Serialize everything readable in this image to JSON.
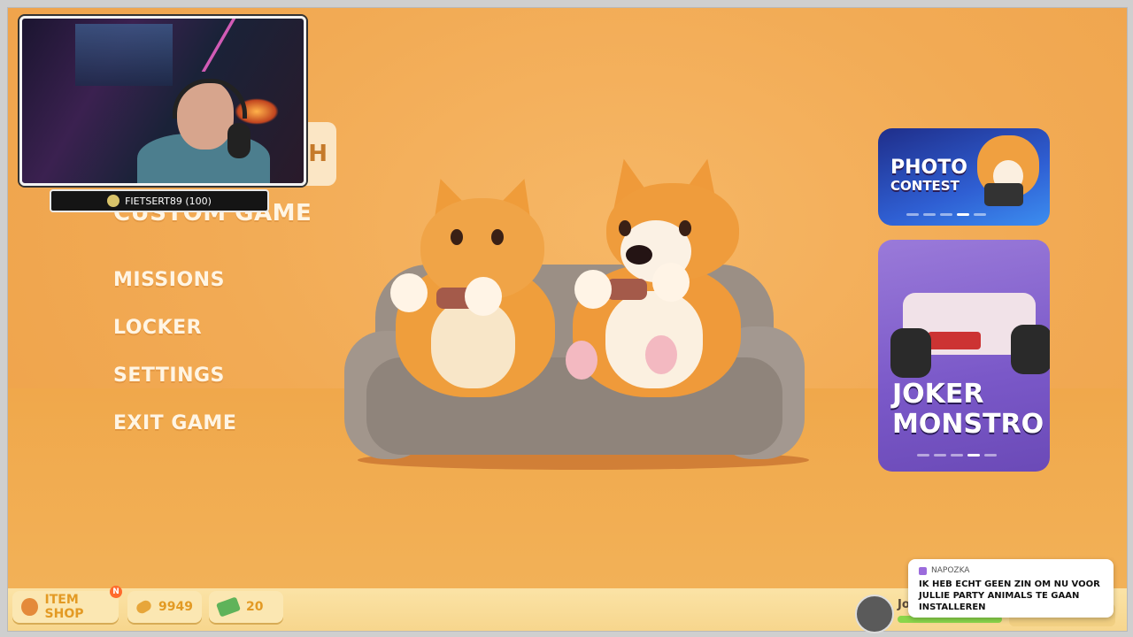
{
  "stream_overlay": {
    "webcam_label": "streamer-webcam",
    "subscriber": "FIETSERT89 (100)"
  },
  "main_menu": {
    "custom_game": "CUSTOM GAME",
    "items": [
      {
        "label": "MISSIONS"
      },
      {
        "label": "LOCKER"
      },
      {
        "label": "SETTINGS"
      },
      {
        "label": "EXIT GAME"
      }
    ],
    "top_button_glyph": "H"
  },
  "promos": {
    "photo_contest": {
      "line1": "PHOTO",
      "line2": "CONTEST"
    },
    "joker": {
      "line1": "JOKER",
      "line2": "MONSTRO"
    }
  },
  "bottom_bar": {
    "item_shop": "ITEM SHOP",
    "shop_badge": "N",
    "bones": "9949",
    "cash": "20",
    "player_name": "Jo"
  },
  "chat": {
    "user": "NAPOZKA",
    "message": "IK HEB ECHT GEEN ZIN OM NU VOOR JULLIE PARTY ANIMALS TE GAAN INSTALLEREN"
  },
  "colors": {
    "background": "#f2ab55",
    "menu_text": "#fff5e4",
    "accent_orange": "#e39a24",
    "card_photo": "#2f5fd3",
    "card_joker": "#7a58c8"
  }
}
